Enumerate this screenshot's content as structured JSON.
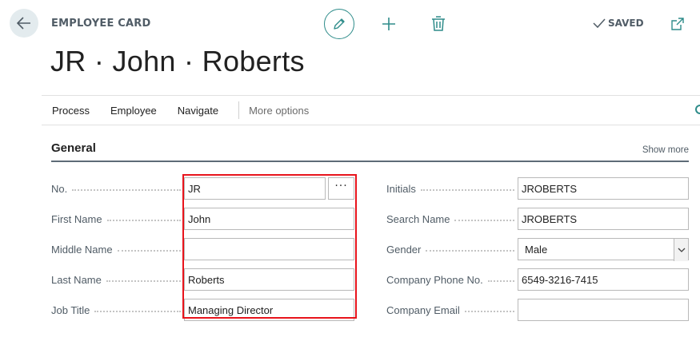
{
  "header": {
    "page_caption": "EMPLOYEE CARD",
    "saved_status": "SAVED",
    "record_title": "JR · John · Roberts"
  },
  "actions": {
    "process": "Process",
    "employee": "Employee",
    "navigate": "Navigate",
    "more_options": "More options"
  },
  "section": {
    "title": "General",
    "show_more": "Show more"
  },
  "fields_left": [
    {
      "label": "No.",
      "value": "JR"
    },
    {
      "label": "First Name",
      "value": "John"
    },
    {
      "label": "Middle Name",
      "value": ""
    },
    {
      "label": "Last Name",
      "value": "Roberts"
    },
    {
      "label": "Job Title",
      "value": "Managing Director"
    }
  ],
  "fields_right": [
    {
      "label": "Initials",
      "value": "JROBERTS"
    },
    {
      "label": "Search Name",
      "value": "JROBERTS"
    },
    {
      "label": "Gender",
      "value": "Male"
    },
    {
      "label": "Company Phone No.",
      "value": "6549-3216-7415"
    },
    {
      "label": "Company Email",
      "value": ""
    }
  ],
  "assist_edit_label": "···",
  "colors": {
    "accent": "#2e8c8a",
    "highlight": "#e8141c",
    "label": "#505c66"
  }
}
